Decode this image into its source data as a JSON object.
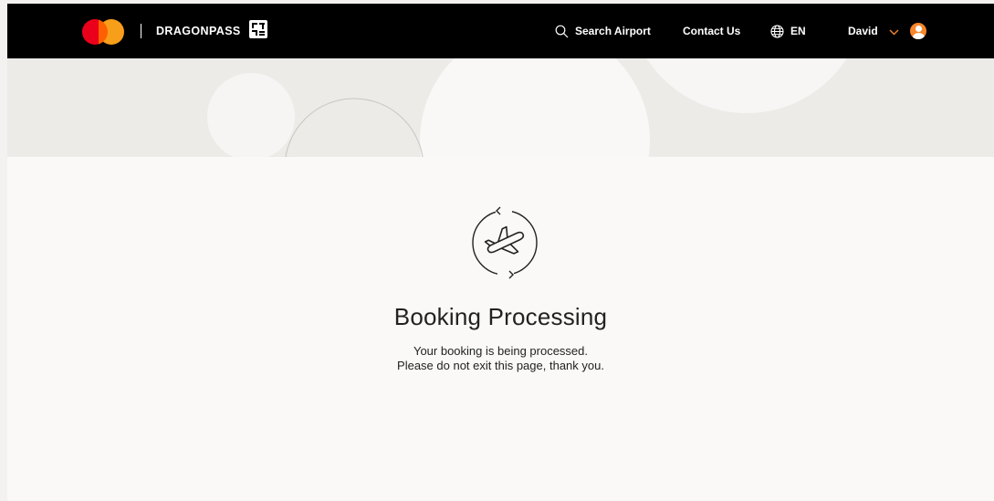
{
  "header": {
    "brand_name": "DRAGONPASS",
    "search_label": "Search Airport",
    "contact_label": "Contact Us",
    "language_label": "EN",
    "user_name": "David"
  },
  "main": {
    "title": "Booking Processing",
    "message_line1": "Your booking is being processed.",
    "message_line2": "Please do not exit this page, thank you."
  },
  "icons": {
    "brand_logo": "mastercard-logo-icon",
    "search": "search-icon",
    "language": "globe-icon",
    "user_menu": "chevron-down-icon",
    "avatar": "user-avatar-icon",
    "status": "plane-refresh-icon"
  },
  "colors": {
    "header_bg": "#000000",
    "accent": "#f7862a",
    "hero_bg": "#edebe8",
    "page_bg": "#faf9f7"
  }
}
